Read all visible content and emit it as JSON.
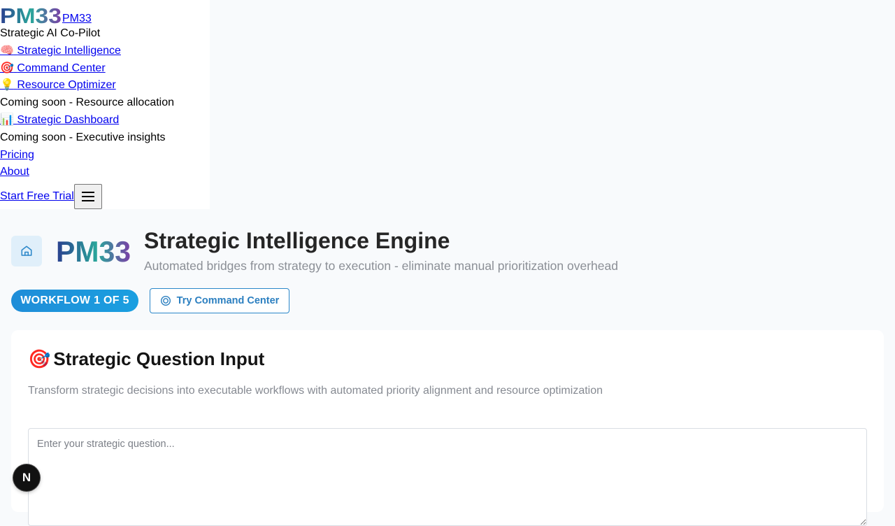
{
  "nav": {
    "logo_text": "PM33",
    "brand_link": "PM33",
    "tagline": "Strategic AI Co-Pilot",
    "items": [
      {
        "emoji": "🧠",
        "label": "Strategic Intelligence"
      },
      {
        "emoji": "🎯",
        "label": "Command Center"
      },
      {
        "emoji": "💡",
        "label": "Resource Optimizer",
        "note": "Coming soon - Resource allocation"
      },
      {
        "emoji": "📊",
        "label": "Strategic Dashboard",
        "note": "Coming soon - Executive insights"
      }
    ],
    "pricing": "Pricing",
    "about": "About",
    "cta": "Start Free Trial"
  },
  "header": {
    "logo_text": "PM33",
    "title": "Strategic Intelligence Engine",
    "subtitle": "Automated bridges from strategy to execution - eliminate manual prioritization overhead"
  },
  "workflow_badge": "WORKFLOW 1 OF 5",
  "command_button": "Try Command Center",
  "card": {
    "emoji": "🎯",
    "title": "Strategic Question Input",
    "description": "Transform strategic decisions into executable workflows with automated priority alignment and resource optimization",
    "input_placeholder": "Enter your strategic question..."
  },
  "dev_badge": "N",
  "colors": {
    "accent": "#1f8dd8",
    "logo_blue": "#2a3f8f",
    "logo_teal": "#2aa79b",
    "logo_purple": "#7b3fa6"
  }
}
